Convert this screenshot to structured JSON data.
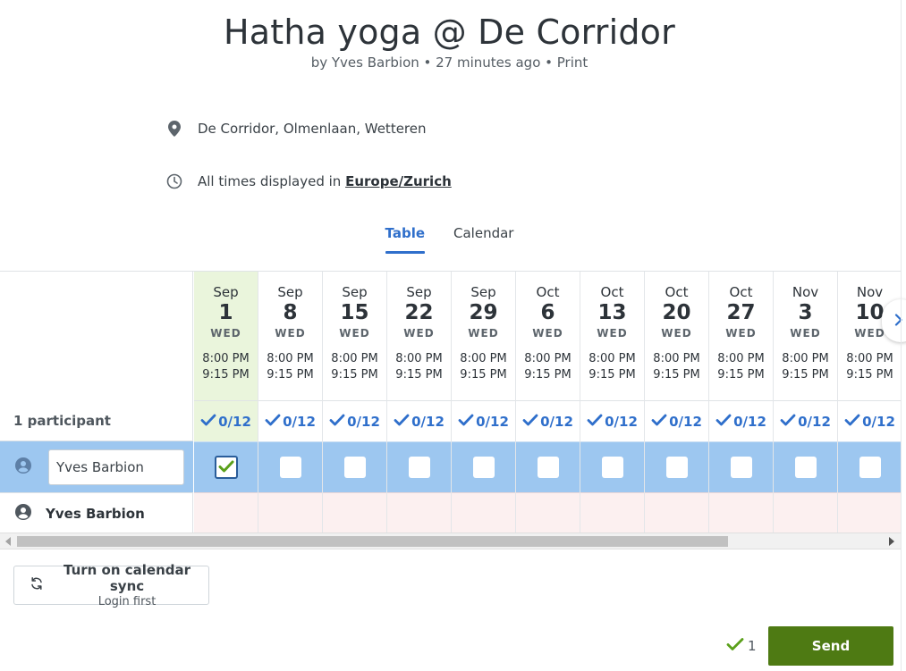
{
  "poll": {
    "title": "Hatha yoga @ De Corridor",
    "byline": "by Yves Barbion • 27 minutes ago • Print",
    "location": "De Corridor, Olmenlaan, Wetteren",
    "timezone_prefix": "All times displayed in",
    "timezone": "Europe/Zurich"
  },
  "tabs": [
    {
      "label": "Table",
      "active": true
    },
    {
      "label": "Calendar",
      "active": false
    }
  ],
  "table": {
    "participant_count": "1 participant",
    "dates": [
      {
        "month": "Sep",
        "day": "1",
        "weekday": "WED",
        "start": "8:00 PM",
        "end": "9:15 PM",
        "count": "0/12",
        "selected": true
      },
      {
        "month": "Sep",
        "day": "8",
        "weekday": "WED",
        "start": "8:00 PM",
        "end": "9:15 PM",
        "count": "0/12",
        "selected": false
      },
      {
        "month": "Sep",
        "day": "15",
        "weekday": "WED",
        "start": "8:00 PM",
        "end": "9:15 PM",
        "count": "0/12",
        "selected": false
      },
      {
        "month": "Sep",
        "day": "22",
        "weekday": "WED",
        "start": "8:00 PM",
        "end": "9:15 PM",
        "count": "0/12",
        "selected": false
      },
      {
        "month": "Sep",
        "day": "29",
        "weekday": "WED",
        "start": "8:00 PM",
        "end": "9:15 PM",
        "count": "0/12",
        "selected": false
      },
      {
        "month": "Oct",
        "day": "6",
        "weekday": "WED",
        "start": "8:00 PM",
        "end": "9:15 PM",
        "count": "0/12",
        "selected": false
      },
      {
        "month": "Oct",
        "day": "13",
        "weekday": "WED",
        "start": "8:00 PM",
        "end": "9:15 PM",
        "count": "0/12",
        "selected": false
      },
      {
        "month": "Oct",
        "day": "20",
        "weekday": "WED",
        "start": "8:00 PM",
        "end": "9:15 PM",
        "count": "0/12",
        "selected": false
      },
      {
        "month": "Oct",
        "day": "27",
        "weekday": "WED",
        "start": "8:00 PM",
        "end": "9:15 PM",
        "count": "0/12",
        "selected": false
      },
      {
        "month": "Nov",
        "day": "3",
        "weekday": "WED",
        "start": "8:00 PM",
        "end": "9:15 PM",
        "count": "0/12",
        "selected": false
      },
      {
        "month": "Nov",
        "day": "10",
        "weekday": "WED",
        "start": "8:00 PM",
        "end": "9:15 PM",
        "count": "0/12",
        "selected": false
      }
    ],
    "current_user_input": "Yves Barbion",
    "other_participant": "Yves Barbion"
  },
  "footer": {
    "sync_label": "Turn on calendar sync",
    "sync_sublabel": "Login first",
    "selected_count": "1",
    "send_label": "Send"
  },
  "colors": {
    "accent": "#2f6fcb",
    "selected_column": "#eaf5dc",
    "selection_row": "#9dc7f0",
    "other_row": "#fcf0f0",
    "send_button": "#4e7a13",
    "check_green": "#5aa01a"
  },
  "icons": {
    "location": "map-pin-icon",
    "timezone": "clock-icon",
    "participant": "user-circle-icon",
    "sync": "sync-icon",
    "next": "chevron-right-icon",
    "check": "check-icon"
  }
}
